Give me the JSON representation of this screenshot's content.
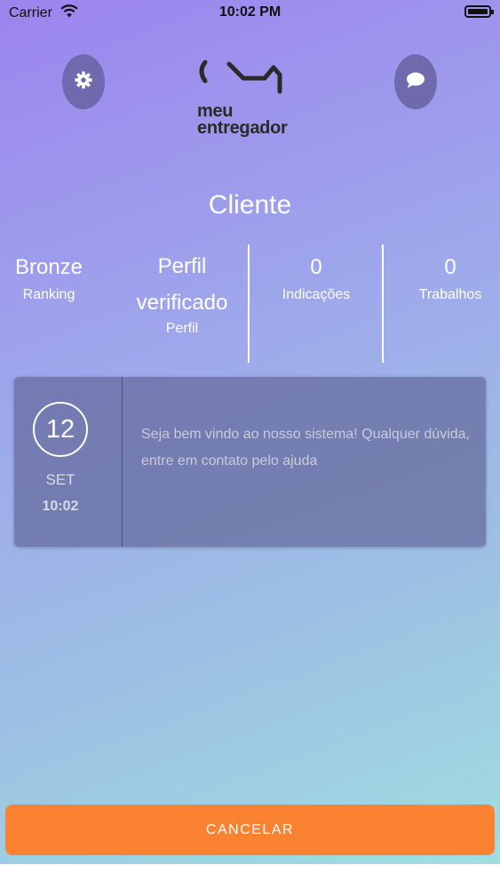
{
  "status_bar": {
    "carrier": "Carrier",
    "time": "10:02 PM"
  },
  "header": {
    "logo_line1": "meu",
    "logo_line2": "entregador",
    "settings_icon": "gear-icon",
    "chat_icon": "chat-bubble-icon"
  },
  "profile": {
    "title": "Cliente"
  },
  "stats": [
    {
      "value": "Bronze",
      "label": "Ranking"
    },
    {
      "value": "Perfil verificado",
      "label": "Perfil"
    },
    {
      "value": "0",
      "label": "Indicações"
    },
    {
      "value": "0",
      "label": "Trabalhos"
    }
  ],
  "notification": {
    "day": "12",
    "month": "SET",
    "time": "10:02",
    "message": "Seja bem vindo ao nosso sistema! Qualquer dúvida, entre em contato pelo ajuda"
  },
  "actions": {
    "cancel_label": "CANCELAR"
  },
  "colors": {
    "accent": "#fb8230",
    "button_bg": "#6f6aae",
    "card_bg": "#64699b"
  }
}
